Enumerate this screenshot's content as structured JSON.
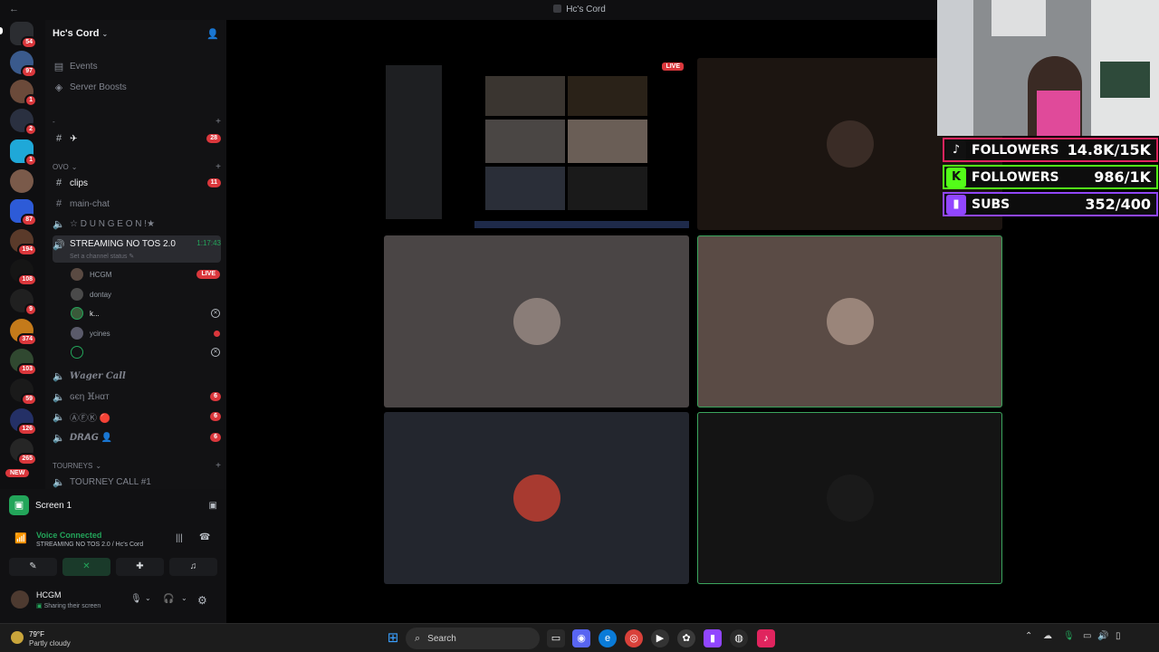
{
  "window": {
    "title": "Hc's Cord",
    "back": "←",
    "forward": "→"
  },
  "rail": {
    "badges": [
      "54",
      "97",
      "1",
      "2",
      "1",
      "87",
      "194",
      "108",
      "9",
      "374",
      "103",
      "59",
      "126",
      "265"
    ],
    "new_label": "NEW"
  },
  "sidebar": {
    "server_name": "Hc's Cord",
    "items": [
      {
        "label": "Events"
      },
      {
        "label": "Server Boosts"
      }
    ],
    "category_top": "-",
    "channel_plane": {
      "label": "✈",
      "badge": "28"
    },
    "category_ovo": "OVO",
    "channels": [
      {
        "label": "clips",
        "badge": "11"
      },
      {
        "label": "main-chat"
      },
      {
        "label": "☆ D U N G E O N !★"
      }
    ],
    "voice_active": {
      "label": "STREAMING NO TOS 2.0",
      "timer": "1:17:43",
      "status": "Set a channel status ✎"
    },
    "voice_users": [
      {
        "name": "HCGM",
        "tag": "LIVE"
      },
      {
        "name": "dontay"
      },
      {
        "name": "k..."
      },
      {
        "name": "ycines"
      },
      {
        "name": ""
      }
    ],
    "voice_channels": [
      {
        "label": "𝑾𝒂𝒈𝒆𝒓 𝑪𝒂𝒍𝒍"
      },
      {
        "label": "ɢєη ⴼнαт",
        "badge": "6"
      },
      {
        "label": "ⒶⒻⓀ 🔴",
        "badge": "6"
      },
      {
        "label": "𝘿𝙍𝘼𝙂 👤",
        "badge": "6"
      }
    ],
    "category_tourneys": "TOURNEYS",
    "tourney_channel": "TOURNEY CALL #1"
  },
  "bottom": {
    "screen_label": "Screen 1",
    "voice_connected": "Voice Connected",
    "voice_location": "STREAMING NO TOS 2.0 / Hc's Cord",
    "user_name": "HCGM",
    "user_status": "Sharing their screen"
  },
  "stage": {
    "live_badge": "LIVE"
  },
  "stats": [
    {
      "platform": "tiktok",
      "label": "FOLLOWERS",
      "value": "14.8K/15K",
      "color": "#e0245e"
    },
    {
      "platform": "kick",
      "label": "FOLLOWERS",
      "value": "986/1K",
      "color": "#53fc18"
    },
    {
      "platform": "twitch",
      "label": "SUBS",
      "value": "352/400",
      "color": "#9146ff"
    }
  ],
  "taskbar": {
    "temperature": "79°F",
    "condition": "Partly cloudy",
    "search_label": "Search"
  }
}
